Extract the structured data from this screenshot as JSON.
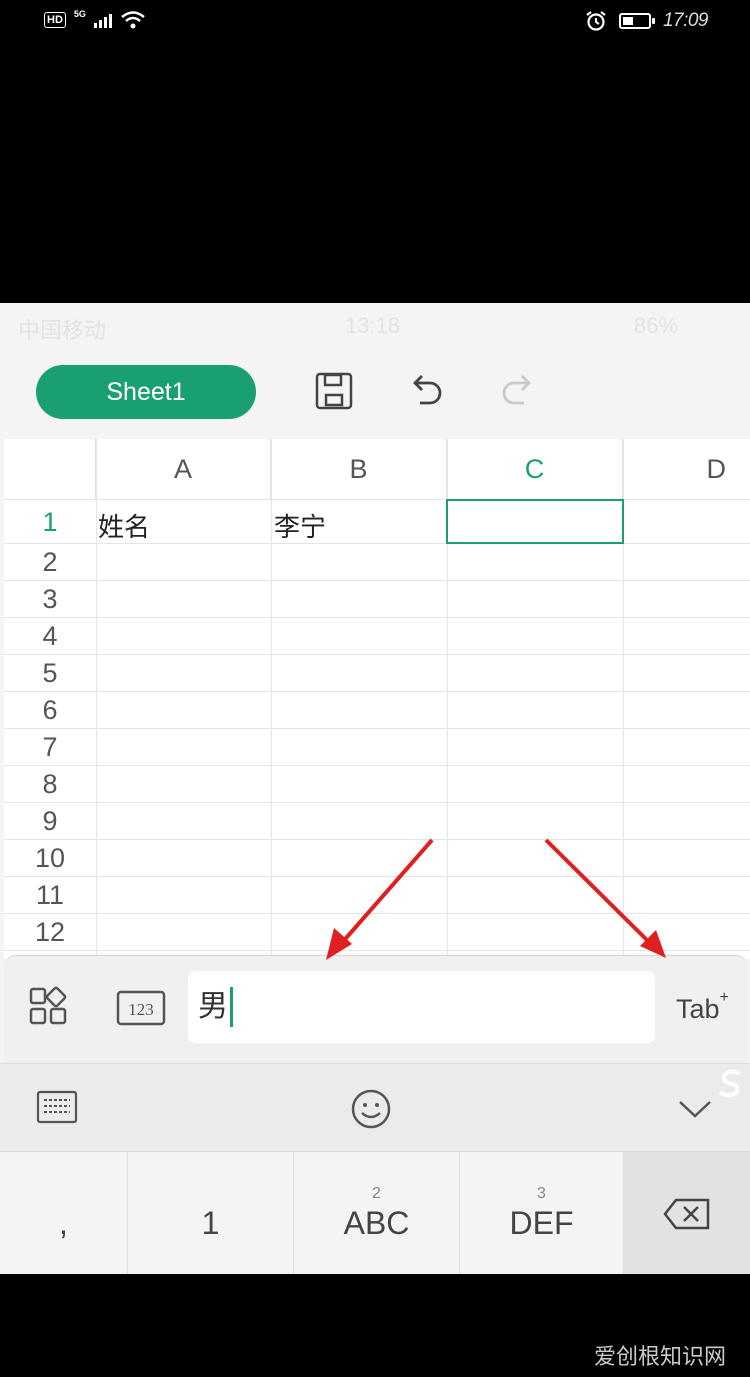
{
  "outer_status": {
    "hd": "HD",
    "network": "5G",
    "time": "17:09"
  },
  "inner_status": {
    "carrier": "中国移动",
    "time": "13:18",
    "battery": "86%"
  },
  "toolbar": {
    "sheet_tab": "Sheet1"
  },
  "grid": {
    "columns": [
      "A",
      "B",
      "C",
      "D"
    ],
    "selected_column": "C",
    "rows": [
      "1",
      "2",
      "3",
      "4",
      "5",
      "6",
      "7",
      "8",
      "9",
      "10",
      "11",
      "12"
    ],
    "cells": {
      "A1": "姓名",
      "B1": "李宁"
    },
    "selected_cell": "C1"
  },
  "input_bar": {
    "value": "男",
    "tab_label": "Tab"
  },
  "keyboard": {
    "keys": [
      {
        "num": "",
        "label": ","
      },
      {
        "num": "",
        "label": "1"
      },
      {
        "num": "2",
        "label": "ABC"
      },
      {
        "num": "3",
        "label": "DEF"
      }
    ]
  },
  "colors": {
    "accent": "#1a9f73",
    "annotation_arrow": "#e02020"
  },
  "watermark": "爱创根知识网"
}
